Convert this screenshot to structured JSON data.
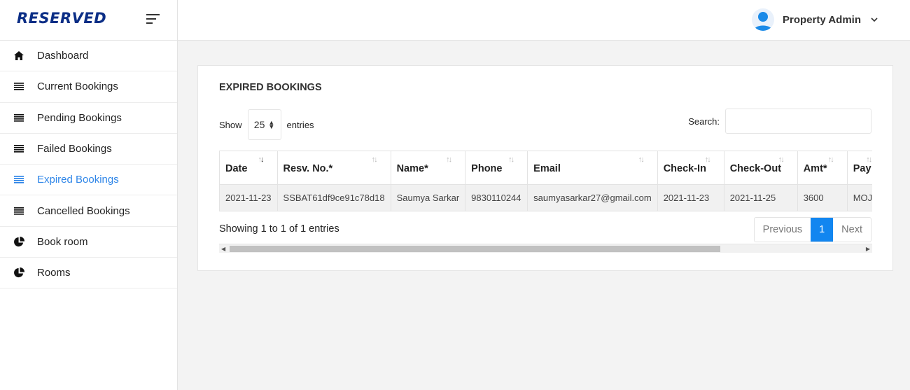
{
  "brand": {
    "logo": "RESERVED"
  },
  "sidebar": {
    "items": [
      {
        "label": "Dashboard",
        "icon": "home-icon",
        "active": false
      },
      {
        "label": "Current Bookings",
        "icon": "list-icon",
        "active": false
      },
      {
        "label": "Pending Bookings",
        "icon": "list-icon",
        "active": false
      },
      {
        "label": "Failed Bookings",
        "icon": "list-icon",
        "active": false
      },
      {
        "label": "Expired Bookings",
        "icon": "list-icon",
        "active": true
      },
      {
        "label": "Cancelled Bookings",
        "icon": "list-icon",
        "active": false
      },
      {
        "label": "Book room",
        "icon": "pie-chart-icon",
        "active": false
      },
      {
        "label": "Rooms",
        "icon": "pie-chart-icon",
        "active": false
      }
    ]
  },
  "header": {
    "user_name": "Property Admin"
  },
  "card": {
    "title": "EXPIRED BOOKINGS",
    "show_label": "Show",
    "entries_value": "25",
    "entries_label": "entries",
    "search_label": "Search:",
    "search_value": ""
  },
  "table": {
    "columns": [
      "Date",
      "Resv. No.*",
      "Name*",
      "Phone",
      "Email",
      "Check-In",
      "Check-Out",
      "Amt*",
      "Pay Id"
    ],
    "rows": [
      [
        "2021-11-23",
        "SSBAT61df9ce91c78d18",
        "Saumya Sarkar",
        "9830110244",
        "saumyasarkar27@gmail.com",
        "2021-11-23",
        "2021-11-25",
        "3600",
        "MOJO"
      ]
    ]
  },
  "footer": {
    "info": "Showing 1 to 1 of 1 entries",
    "previous": "Previous",
    "page": "1",
    "next": "Next"
  },
  "colors": {
    "accent": "#1286f0",
    "active_nav": "#2f86e8",
    "logo": "#0b2e86"
  }
}
